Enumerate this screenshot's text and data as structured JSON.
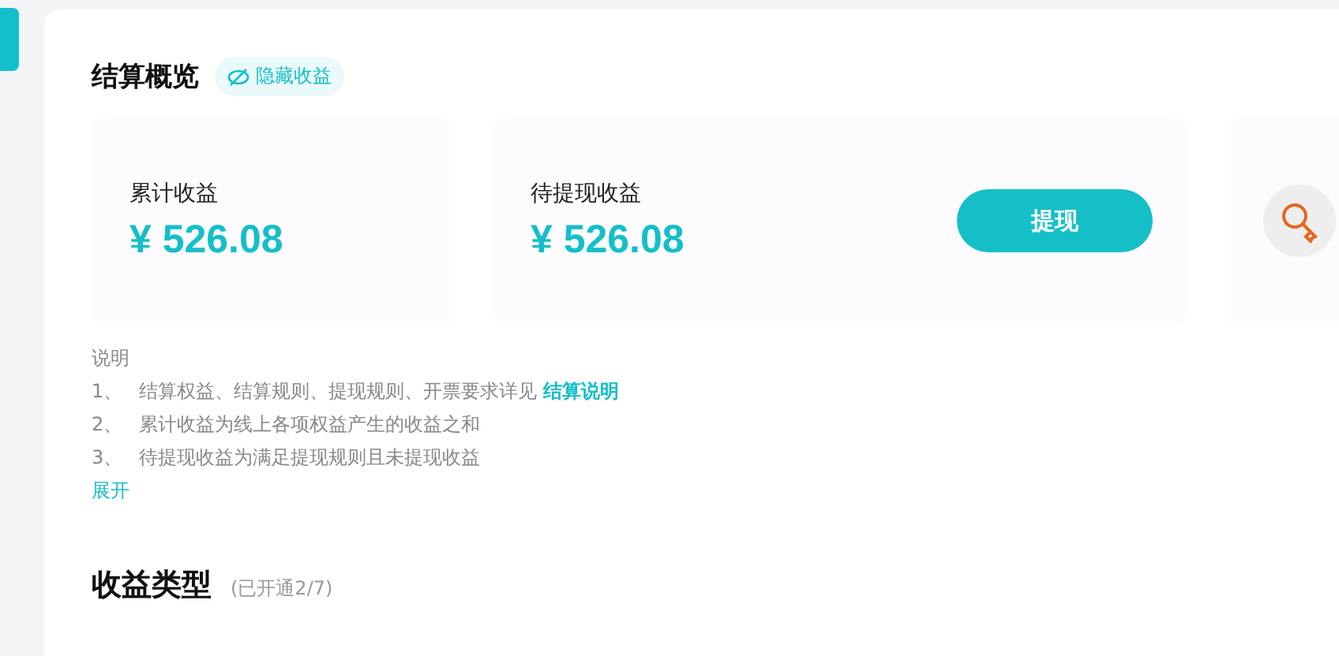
{
  "title": "结算概览",
  "hide_toggle": {
    "label": "隐藏收益"
  },
  "summary_cards": [
    {
      "kind": "stat",
      "label": "累计收益",
      "amount": "¥ 526.08"
    },
    {
      "kind": "withdraw",
      "label": "待提现收益",
      "amount": "¥ 526.08",
      "button": "提现"
    },
    {
      "kind": "icon"
    }
  ],
  "notes": {
    "heading": "说明",
    "items": [
      {
        "index": "1、",
        "text": "结算权益、结算规则、提现规则、开票要求详见",
        "link": "结算说明"
      },
      {
        "index": "2、",
        "text": "累计收益为线上各项权益产生的收益之和"
      },
      {
        "index": "3、",
        "text": "待提现收益为满足提现规则且未提现收益"
      }
    ],
    "expand": "展开"
  },
  "income_types": {
    "title": "收益类型",
    "count": "(已开通2/7)"
  }
}
